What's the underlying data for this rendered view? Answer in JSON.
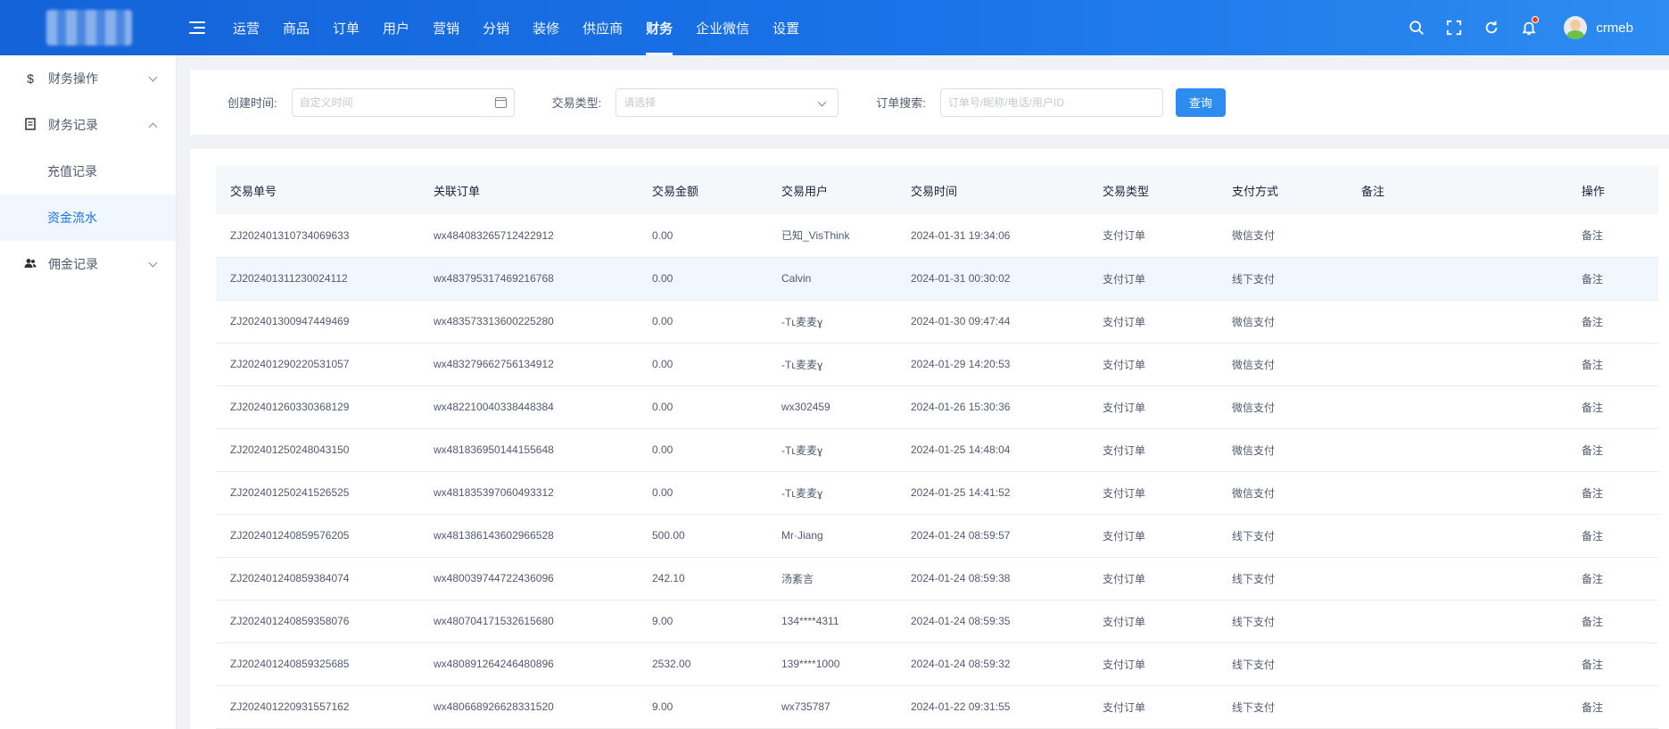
{
  "topnav": {
    "items": [
      {
        "label": "运营"
      },
      {
        "label": "商品"
      },
      {
        "label": "订单"
      },
      {
        "label": "用户"
      },
      {
        "label": "营销"
      },
      {
        "label": "分销"
      },
      {
        "label": "装修"
      },
      {
        "label": "供应商"
      },
      {
        "label": "财务",
        "active": true
      },
      {
        "label": "企业微信"
      },
      {
        "label": "设置"
      }
    ],
    "username": "crmeb"
  },
  "sidebar": {
    "groups": [
      {
        "label": "财务操作",
        "icon": "dollar-icon",
        "expanded": false
      },
      {
        "label": "财务记录",
        "icon": "document-icon",
        "expanded": true,
        "children": [
          {
            "label": "充值记录"
          },
          {
            "label": "资金流水",
            "active": true
          }
        ]
      },
      {
        "label": "佣金记录",
        "icon": "users-icon",
        "expanded": false
      }
    ]
  },
  "filters": {
    "created_label": "创建时间:",
    "created_placeholder": "自定义时间",
    "type_label": "交易类型:",
    "type_placeholder": "请选择",
    "search_label": "订单搜索:",
    "search_placeholder": "订单号/昵称/电话/用户ID",
    "query_button": "查询"
  },
  "table": {
    "columns": [
      "交易单号",
      "关联订单",
      "交易金额",
      "交易用户",
      "交易时间",
      "交易类型",
      "支付方式",
      "备注",
      "操作"
    ],
    "rows": [
      {
        "no": "ZJ202401310734069633",
        "order": "wx484083265712422912",
        "amount": "0.00",
        "user": "已知_VisThink",
        "time": "2024-01-31 19:34:06",
        "type": "支付订单",
        "pay": "微信支付",
        "remark": "",
        "op": "备注"
      },
      {
        "no": "ZJ202401311230024112",
        "order": "wx483795317469216768",
        "amount": "0.00",
        "user": "Calvin",
        "time": "2024-01-31 00:30:02",
        "type": "支付订单",
        "pay": "线下支付",
        "remark": "",
        "op": "备注"
      },
      {
        "no": "ZJ202401300947449469",
        "order": "wx483573313600225280",
        "amount": "0.00",
        "user": "-Tʟ麦麦ɣ",
        "time": "2024-01-30 09:47:44",
        "type": "支付订单",
        "pay": "微信支付",
        "remark": "",
        "op": "备注"
      },
      {
        "no": "ZJ202401290220531057",
        "order": "wx483279662756134912",
        "amount": "0.00",
        "user": "-Tʟ麦麦ɣ",
        "time": "2024-01-29 14:20:53",
        "type": "支付订单",
        "pay": "微信支付",
        "remark": "",
        "op": "备注"
      },
      {
        "no": "ZJ202401260330368129",
        "order": "wx482210040338448384",
        "amount": "0.00",
        "user": "wx302459",
        "time": "2024-01-26 15:30:36",
        "type": "支付订单",
        "pay": "微信支付",
        "remark": "",
        "op": "备注"
      },
      {
        "no": "ZJ202401250248043150",
        "order": "wx481836950144155648",
        "amount": "0.00",
        "user": "-Tʟ麦麦ɣ",
        "time": "2024-01-25 14:48:04",
        "type": "支付订单",
        "pay": "微信支付",
        "remark": "",
        "op": "备注"
      },
      {
        "no": "ZJ202401250241526525",
        "order": "wx481835397060493312",
        "amount": "0.00",
        "user": "-Tʟ麦麦ɣ",
        "time": "2024-01-25 14:41:52",
        "type": "支付订单",
        "pay": "微信支付",
        "remark": "",
        "op": "备注"
      },
      {
        "no": "ZJ202401240859576205",
        "order": "wx481386143602966528",
        "amount": "500.00",
        "user": "Mr·Jiang",
        "time": "2024-01-24 08:59:57",
        "type": "支付订单",
        "pay": "线下支付",
        "remark": "",
        "op": "备注"
      },
      {
        "no": "ZJ202401240859384074",
        "order": "wx480039744722436096",
        "amount": "242.10",
        "user": "汤紊言",
        "time": "2024-01-24 08:59:38",
        "type": "支付订单",
        "pay": "线下支付",
        "remark": "",
        "op": "备注"
      },
      {
        "no": "ZJ202401240859358076",
        "order": "wx480704171532615680",
        "amount": "9.00",
        "user": "134****4311",
        "time": "2024-01-24 08:59:35",
        "type": "支付订单",
        "pay": "线下支付",
        "remark": "",
        "op": "备注"
      },
      {
        "no": "ZJ202401240859325685",
        "order": "wx480891264246480896",
        "amount": "2532.00",
        "user": "139****1000",
        "time": "2024-01-24 08:59:32",
        "type": "支付订单",
        "pay": "线下支付",
        "remark": "",
        "op": "备注"
      },
      {
        "no": "ZJ202401220931557162",
        "order": "wx480668926628331520",
        "amount": "9.00",
        "user": "wx735787",
        "time": "2024-01-22 09:31:55",
        "type": "支付订单",
        "pay": "线下支付",
        "remark": "",
        "op": "备注"
      }
    ]
  }
}
